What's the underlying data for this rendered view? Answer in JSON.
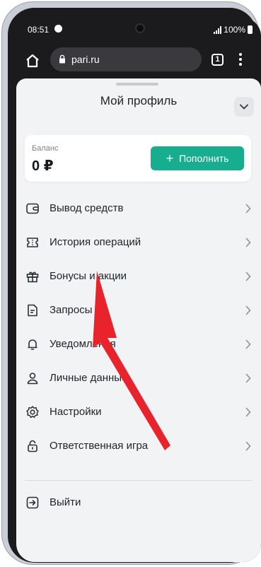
{
  "status_bar": {
    "time": "08:51",
    "battery": "100%"
  },
  "browser": {
    "url": "pari.ru",
    "tab_count": "1"
  },
  "profile": {
    "title": "Мой профиль",
    "balance_label": "Баланс",
    "balance_value": "0 ₽",
    "topup_label": "Пополнить"
  },
  "menu": {
    "items": [
      {
        "label": "Вывод средств",
        "icon": "wallet-icon"
      },
      {
        "label": "История операций",
        "icon": "ticket-icon"
      },
      {
        "label": "Бонусы и акции",
        "icon": "gift-icon"
      },
      {
        "label": "Запросы",
        "icon": "document-icon"
      },
      {
        "label": "Уведомления",
        "icon": "bell-icon"
      },
      {
        "label": "Личные данные",
        "icon": "user-icon"
      },
      {
        "label": "Настройки",
        "icon": "gear-icon"
      },
      {
        "label": "Ответственная игра",
        "icon": "lock-icon"
      }
    ],
    "logout_label": "Выйти"
  },
  "colors": {
    "accent": "#16ae8f",
    "annotation_arrow": "#e8232c"
  }
}
